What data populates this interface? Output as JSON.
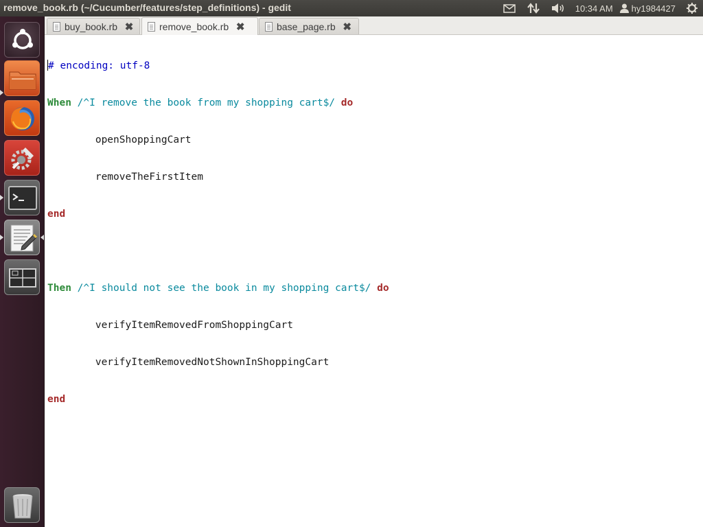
{
  "window": {
    "title": "remove_book.rb (~/Cucumber/features/step_definitions) - gedit"
  },
  "panel": {
    "time": "10:34 AM",
    "user": "hy1984427"
  },
  "launcher": {
    "items": [
      {
        "name": "dash",
        "icon": "ubuntu-logo-icon"
      },
      {
        "name": "files",
        "icon": "folder-icon"
      },
      {
        "name": "firefox",
        "icon": "firefox-icon"
      },
      {
        "name": "system-settings",
        "icon": "settings-tools-icon"
      },
      {
        "name": "terminal",
        "icon": "terminal-icon"
      },
      {
        "name": "gedit",
        "icon": "text-editor-icon"
      },
      {
        "name": "workspace-switcher",
        "icon": "workspace-icon"
      },
      {
        "name": "trash",
        "icon": "trash-icon"
      }
    ]
  },
  "tabs": [
    {
      "label": "buy_book.rb",
      "active": false
    },
    {
      "label": "remove_book.rb",
      "active": true
    },
    {
      "label": "base_page.rb",
      "active": false
    }
  ],
  "code": {
    "line1": {
      "comment": "# encoding: utf-8"
    },
    "line2": {
      "kw": "When",
      "regex": "/^I remove the book from my shopping cart$/",
      "do": "do"
    },
    "line3": {
      "text": "openShoppingCart"
    },
    "line4": {
      "text": "removeTheFirstItem"
    },
    "line5": {
      "end": "end"
    },
    "line7": {
      "kw": "Then",
      "regex": "/^I should not see the book in my shopping cart$/",
      "do": "do"
    },
    "line8": {
      "text": "verifyItemRemovedFromShoppingCart"
    },
    "line9": {
      "text": "verifyItemRemovedNotShownInShoppingCart"
    },
    "line10": {
      "end": "end"
    }
  },
  "colors": {
    "comment": "#0000c0",
    "step_keyword": "#2e8b3a",
    "regex": "#0a8a9e",
    "keyword": "#a52a2a"
  }
}
